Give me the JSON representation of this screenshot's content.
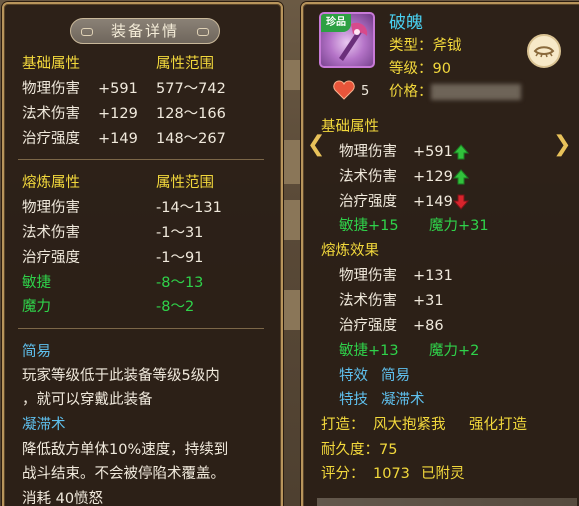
{
  "left": {
    "title": "装备详情",
    "base_header": "基础属性",
    "base_range_header": "属性范围",
    "base_stats": [
      {
        "name": "物理伤害",
        "value": "+591",
        "range": "577～742"
      },
      {
        "name": "法术伤害",
        "value": "+129",
        "range": "128～166"
      },
      {
        "name": "治疗强度",
        "value": "+149",
        "range": "148～267"
      }
    ],
    "refine_header": "熔炼属性",
    "refine_range_header": "属性范围",
    "refine_stats": [
      {
        "name": "物理伤害",
        "range": "-14～131"
      },
      {
        "name": "法术伤害",
        "range": "-1～31"
      },
      {
        "name": "治疗强度",
        "range": "-1～91"
      },
      {
        "name": "敏捷",
        "range": "-8～13"
      },
      {
        "name": "魔力",
        "range": "-8～2"
      }
    ],
    "trait1_title": "简易",
    "trait1_desc_line1": "玩家等级低于此装备等级5级内",
    "trait1_desc_line2": "，就可以穿戴此装备",
    "trait2_title": "凝滞术",
    "trait2_desc_line1": "降低敌方单体10%速度，持续到",
    "trait2_desc_line2": "战斗结束。不会被停陷术覆盖。",
    "trait2_cost": "消耗 40愤怒"
  },
  "right": {
    "rare_badge": "珍品",
    "item_name": "破魄",
    "type_label": "类型：斧钺",
    "level_label": "等级：90",
    "price_label": "价格：",
    "heart_count": "5",
    "base_header": "基础属性",
    "base_stats": [
      {
        "name": "物理伤害",
        "value": "+591",
        "trend": "up"
      },
      {
        "name": "法术伤害",
        "value": "+129",
        "trend": "up"
      },
      {
        "name": "治疗强度",
        "value": "+149",
        "trend": "down"
      }
    ],
    "agility_bonus": "敏捷+15",
    "magic_bonus": "魔力+31",
    "refine_header": "熔炼效果",
    "refine_stats": [
      {
        "name": "物理伤害",
        "value": "+131"
      },
      {
        "name": "法术伤害",
        "value": "+31"
      },
      {
        "name": "治疗强度",
        "value": "+86"
      }
    ],
    "refine_agility": "敏捷+13",
    "refine_magic": "魔力+2",
    "effect_label": "特效",
    "effect_value": "简易",
    "skill_label": "特技",
    "skill_value": "凝滞术",
    "forge_label": "打造：",
    "forge_value": "风大抱紧我",
    "forge_extra": "强化打造",
    "durability": "耐久度：75",
    "score_label": "评分：",
    "score_value": "1073",
    "spirit_label": "已附灵"
  },
  "colors": {
    "accent_yellow": "#f2d83c",
    "stat_white": "#f0e9dc",
    "bonus_green": "#2fd24a",
    "skill_blue": "#5fc0ee",
    "border_gold": "#b8955c",
    "up_arrow": "#31c23c",
    "down_arrow": "#d8242c"
  }
}
